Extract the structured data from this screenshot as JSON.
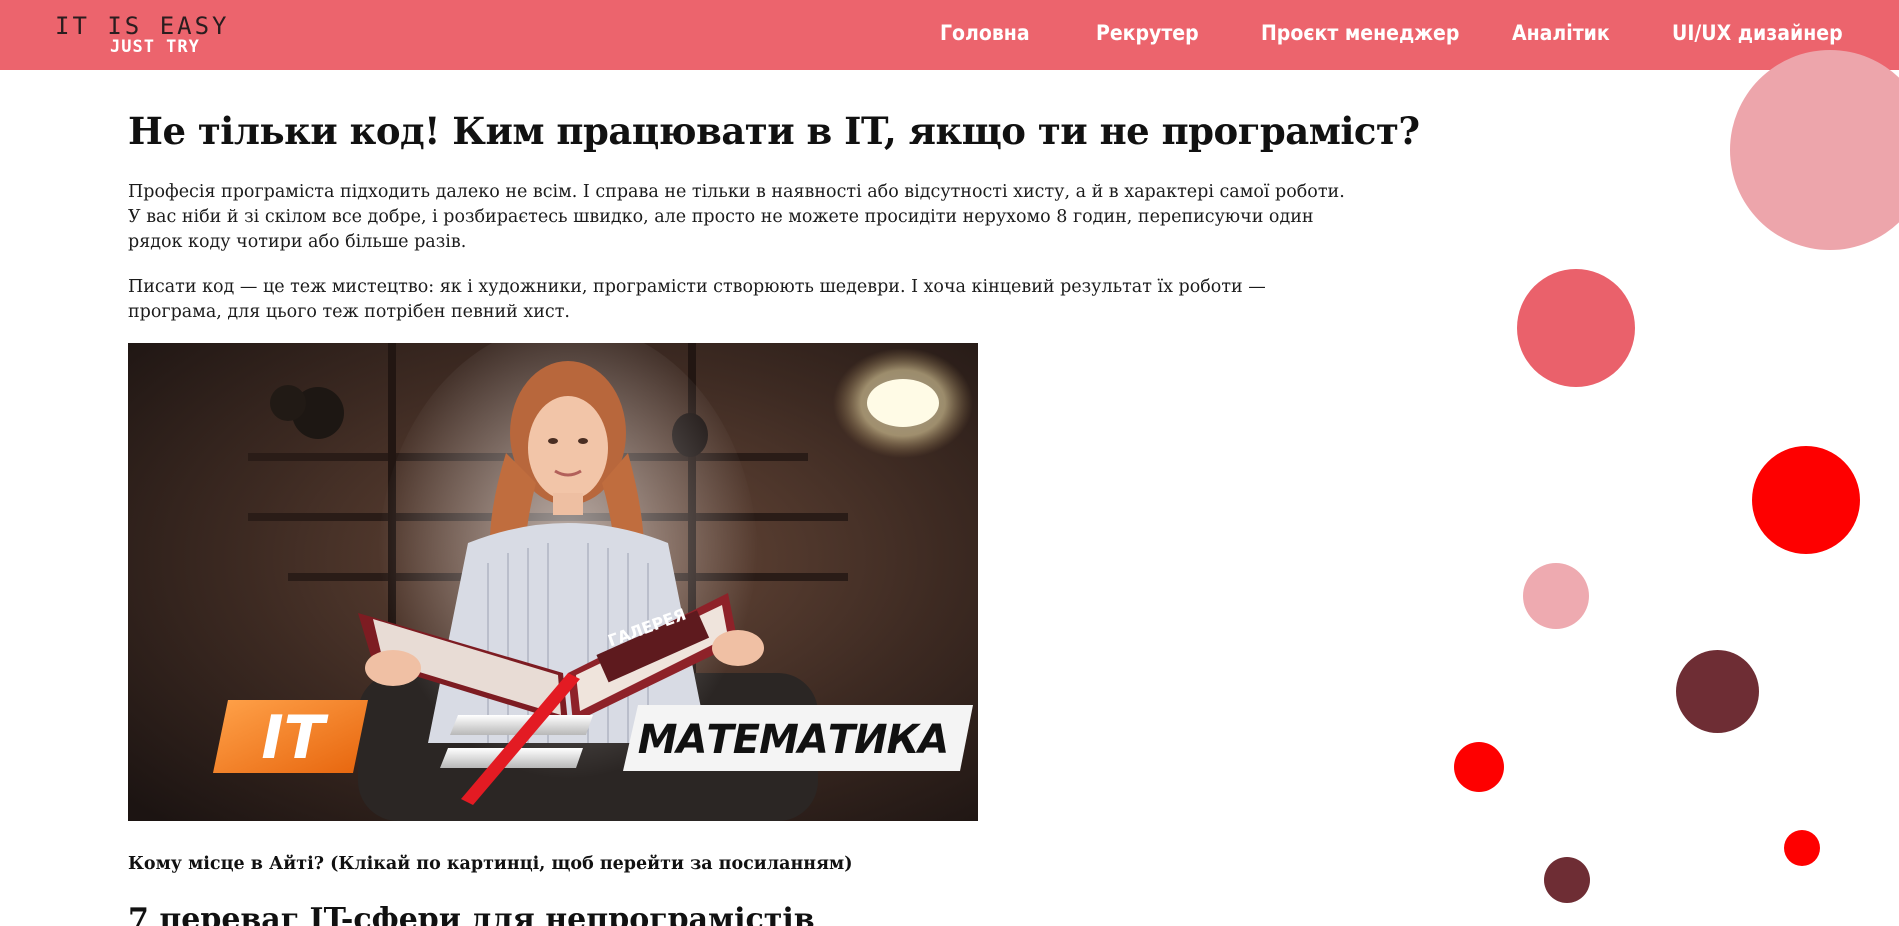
{
  "header": {
    "logo": {
      "line1": "IT IS EASY",
      "line2": "JUST TRY"
    },
    "nav": [
      {
        "label": "Головна"
      },
      {
        "label": "Рекрутер"
      },
      {
        "label": "Проєкт менеджер"
      },
      {
        "label": "Аналітик"
      },
      {
        "label": "UI/UX дизайнер"
      }
    ]
  },
  "article": {
    "title": "Не тільки код! Ким працювати в IT, якщо ти не програміст?",
    "paragraphs": [
      "Професія програміста підходить далеко не всім. І справа не тільки в наявності або відсутності хисту, а й в характері самої роботи. У вас ніби й зі скілом все добре, і розбираєтесь швидко, але просто не можете просидіти нерухомо 8 годин, переписуючи один рядок коду чотири або більше разів.",
      "Писати код — це теж мистецтво: як і художники, програмісти створюють шедеври. І хоча кінцевий результат їх роботи — програма, для цього теж потрібен певний хист."
    ],
    "image": {
      "badge_left": "IT",
      "badge_right": "МАТЕМАТИКА",
      "book_title": "ГАЛЕРЕЯ"
    },
    "caption": "Кому місце в Айті? (Клікай по картинці, щоб перейти за посиланням)",
    "subheading": "7 переваг IT-сфери для непрограмістів"
  },
  "colors": {
    "header_bg": "#ec646d",
    "circle_light_pink": "#eda5ab",
    "circle_coral": "#ea616b",
    "circle_red": "#fe0000",
    "circle_pale_pink": "#eeaab0",
    "circle_maroon": "#6e2d34"
  }
}
